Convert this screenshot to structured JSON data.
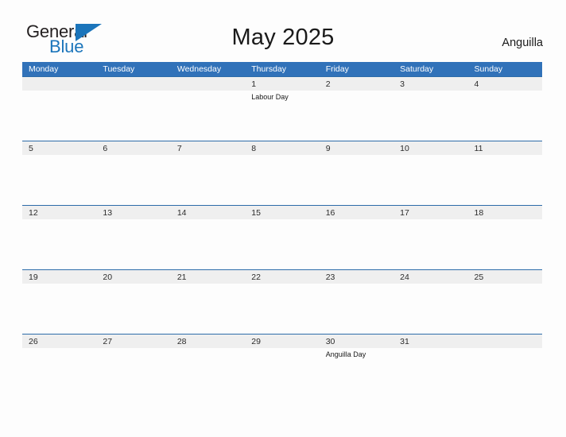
{
  "brand": {
    "name_top": "General",
    "name_bottom": "Blue",
    "triangle_icon": "blue-triangle-icon",
    "color_dark": "#231f20",
    "color_blue": "#1b75bb"
  },
  "header": {
    "title": "May 2025",
    "country": "Anguilla"
  },
  "theme": {
    "header_blue": "#3172b9",
    "band_gray": "#efefef",
    "band_border": "#2d6ca9",
    "page_background": "#fdfdfd",
    "text_dark": "#2b2b2b"
  },
  "calendar": {
    "month": "May",
    "year": "2025",
    "weekday_headers": [
      "Monday",
      "Tuesday",
      "Wednesday",
      "Thursday",
      "Friday",
      "Saturday",
      "Sunday"
    ],
    "weeks": [
      [
        {
          "date": "",
          "event": ""
        },
        {
          "date": "",
          "event": ""
        },
        {
          "date": "",
          "event": ""
        },
        {
          "date": "1",
          "event": "Labour Day"
        },
        {
          "date": "2",
          "event": ""
        },
        {
          "date": "3",
          "event": ""
        },
        {
          "date": "4",
          "event": ""
        }
      ],
      [
        {
          "date": "5",
          "event": ""
        },
        {
          "date": "6",
          "event": ""
        },
        {
          "date": "7",
          "event": ""
        },
        {
          "date": "8",
          "event": ""
        },
        {
          "date": "9",
          "event": ""
        },
        {
          "date": "10",
          "event": ""
        },
        {
          "date": "11",
          "event": ""
        }
      ],
      [
        {
          "date": "12",
          "event": ""
        },
        {
          "date": "13",
          "event": ""
        },
        {
          "date": "14",
          "event": ""
        },
        {
          "date": "15",
          "event": ""
        },
        {
          "date": "16",
          "event": ""
        },
        {
          "date": "17",
          "event": ""
        },
        {
          "date": "18",
          "event": ""
        }
      ],
      [
        {
          "date": "19",
          "event": ""
        },
        {
          "date": "20",
          "event": ""
        },
        {
          "date": "21",
          "event": ""
        },
        {
          "date": "22",
          "event": ""
        },
        {
          "date": "23",
          "event": ""
        },
        {
          "date": "24",
          "event": ""
        },
        {
          "date": "25",
          "event": ""
        }
      ],
      [
        {
          "date": "26",
          "event": ""
        },
        {
          "date": "27",
          "event": ""
        },
        {
          "date": "28",
          "event": ""
        },
        {
          "date": "29",
          "event": ""
        },
        {
          "date": "30",
          "event": "Anguilla Day"
        },
        {
          "date": "31",
          "event": ""
        },
        {
          "date": "",
          "event": ""
        }
      ]
    ]
  }
}
